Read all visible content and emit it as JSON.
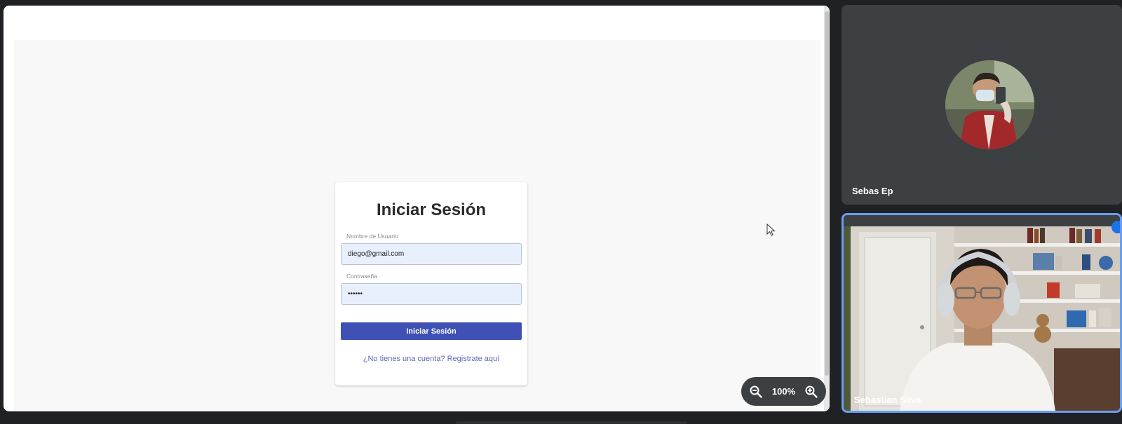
{
  "login": {
    "title": "Iniciar Sesión",
    "username_label": "Nombre de Usuario",
    "username_value": "diego@gmail.com",
    "password_label": "Contraseña",
    "password_value": "••••••",
    "submit_label": "Iniciar Sesión",
    "register_link": "¿No tienes una cuenta? Registrate aquí"
  },
  "zoom": {
    "level": "100%"
  },
  "participants": [
    {
      "name": "Sebas Ep"
    },
    {
      "name": "Sebastian Silva"
    }
  ],
  "colors": {
    "primary_button": "#3f51b5",
    "link": "#5b6ab8",
    "input_background": "#e8f0fe",
    "active_speaker_border": "#6a9df0",
    "tile_background": "#3c4043"
  }
}
